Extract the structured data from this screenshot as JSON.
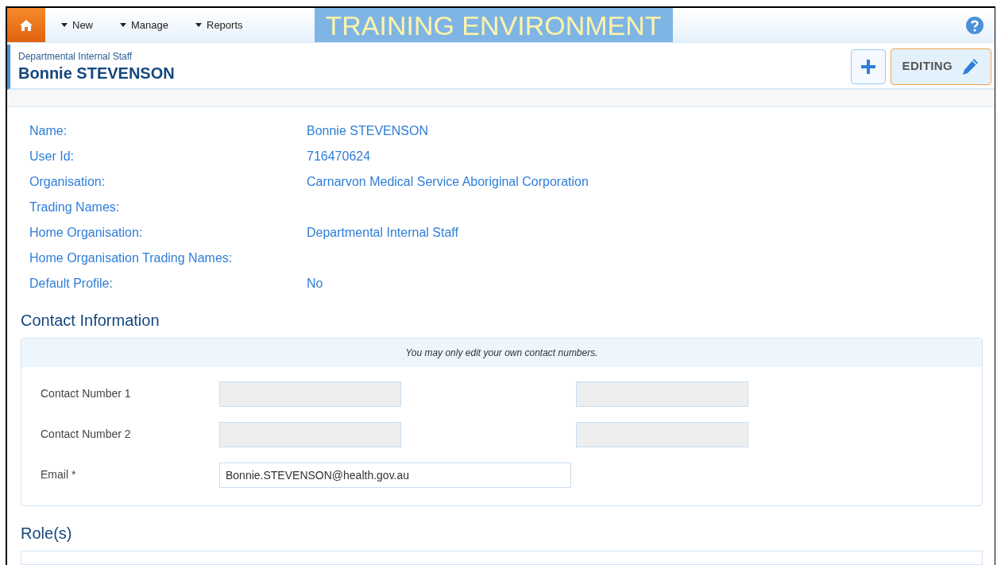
{
  "nav": {
    "menus": [
      {
        "label": "New"
      },
      {
        "label": "Manage"
      },
      {
        "label": "Reports"
      }
    ],
    "banner": "TRAINING ENVIRONMENT"
  },
  "header": {
    "subtitle": "Departmental Internal Staff",
    "title": "Bonnie STEVENSON",
    "editing_button": {
      "label": "EDITING",
      "on": true
    }
  },
  "details": [
    {
      "label": "Name:",
      "value": "Bonnie STEVENSON"
    },
    {
      "label": "User Id:",
      "value": "716470624"
    },
    {
      "label": "Organisation:",
      "value": "Carnarvon Medical Service Aboriginal Corporation"
    },
    {
      "label": "Trading Names:"
    },
    {
      "label": "Home Organisation:",
      "value": "Departmental Internal Staff"
    },
    {
      "label": "Home Organisation Trading Names:"
    },
    {
      "label": "Default Profile:",
      "value": "No"
    }
  ],
  "contact": {
    "heading": "Contact Information",
    "note": "You may only edit your own contact numbers.",
    "rows": [
      {
        "label": "Contact Number 1",
        "fields": [
          {
            "disabled": true
          },
          {
            "disabled": true
          }
        ]
      },
      {
        "label": "Contact Number 2",
        "fields": [
          {
            "disabled": true
          },
          {
            "disabled": true
          }
        ]
      },
      {
        "label": "Email *",
        "fields": [
          {
            "disabled": false,
            "value": "Bonnie.STEVENSON@health.gov.au"
          }
        ]
      }
    ]
  },
  "roles": {
    "heading": "Role(s)"
  }
}
